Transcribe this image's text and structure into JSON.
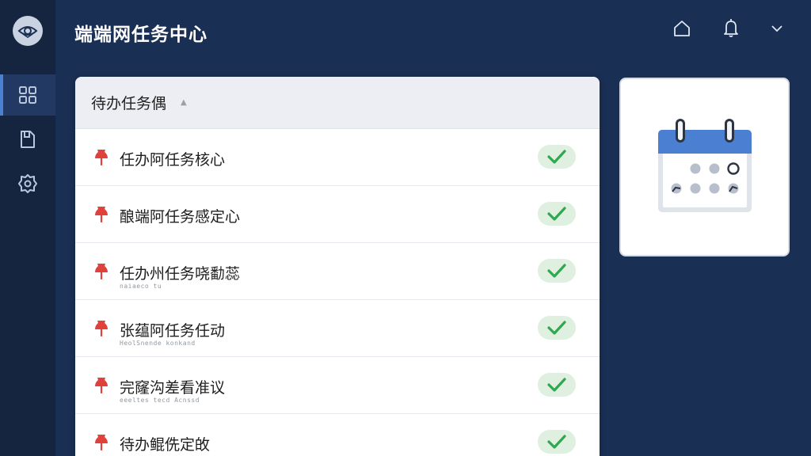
{
  "header": {
    "title": "端端网任务中心"
  },
  "panel": {
    "title": "待办任务偶"
  },
  "tasks": [
    {
      "title": "任办阿任务核心",
      "subtitle": ""
    },
    {
      "title": "酿端阿任务感定心",
      "subtitle": ""
    },
    {
      "title": "任办州任务哓勫蕊",
      "subtitle": "naiaeco tu"
    },
    {
      "title": "张蕴阿任务任动",
      "subtitle": "HeolSnende konkand"
    },
    {
      "title": "完窿沟差看准议",
      "subtitle": "eeeltes tecd Acnssd"
    },
    {
      "title": "待办鲲侁定敀",
      "subtitle": ""
    }
  ],
  "colors": {
    "background": "#1a2f54",
    "sidebar": "#15243f",
    "accent": "#4a7fd1",
    "pin": "#e0413b",
    "check": "#2fa84f",
    "check_bg": "#dff0e1"
  },
  "icons": {
    "logo": "eye-logo-icon",
    "nav": [
      "grid-icon",
      "file-icon",
      "gear-icon"
    ],
    "header": [
      "home-icon",
      "bell-icon",
      "chevron-down-icon"
    ],
    "row": [
      "pin-icon",
      "check-icon"
    ],
    "card": "calendar-icon"
  }
}
